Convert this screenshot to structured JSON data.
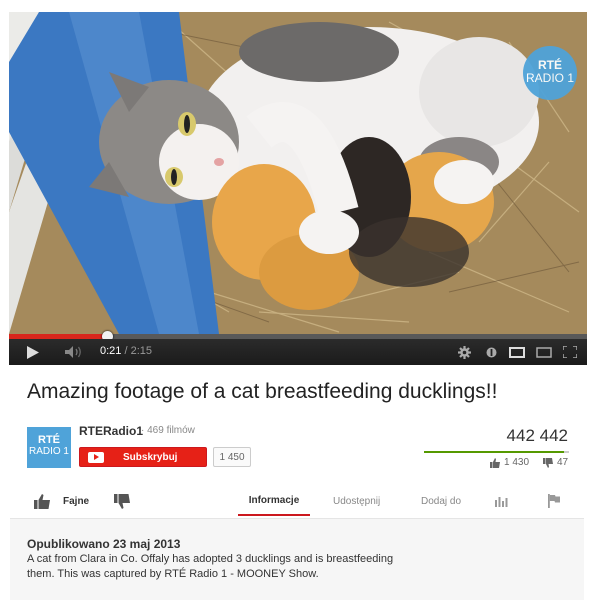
{
  "video": {
    "badge_line1": "RTÉ",
    "badge_line2": "RADIO 1",
    "progress_fraction": 0.169,
    "time_current": "0:21",
    "time_separator": " / ",
    "time_total": "2:15",
    "icons": [
      "play-icon",
      "volume-icon",
      "settings-icon",
      "annotations-icon",
      "theater-mode-icon",
      "miniplayer-icon",
      "fullscreen-icon"
    ],
    "image_description_colors": {
      "straw": "#b89a6a",
      "tub": "#3d7bc4",
      "tile": "#e9e9e6"
    }
  },
  "title": "Amazing footage of a cat breastfeeding ducklings!!",
  "channel": {
    "logo_line1": "RTÉ",
    "logo_line2": "RADIO 1",
    "name": "RTERadio1",
    "video_count": "· 469 filmów",
    "subscribe_label": "Subskrybuj",
    "subscriber_count": "1 450"
  },
  "stats": {
    "views": "442 442",
    "likes": "1 430",
    "dislikes": "47",
    "like_ratio": 0.968
  },
  "actions": {
    "like_label": "Fajne",
    "tab_info": "Informacje",
    "tab_share": "Udostępnij",
    "tab_add": "Dodaj do"
  },
  "description": {
    "published": "Opublikowano 23 maj 2013",
    "text": "A cat from Clara in Co. Offaly has adopted 3 ducklings and is breastfeeding them. This was captured by RTÉ Radio 1 - MOONEY Show."
  },
  "colors": {
    "accent_red": "#e62117",
    "like_green": "#559900",
    "brand_blue": "#4fa3d9"
  }
}
